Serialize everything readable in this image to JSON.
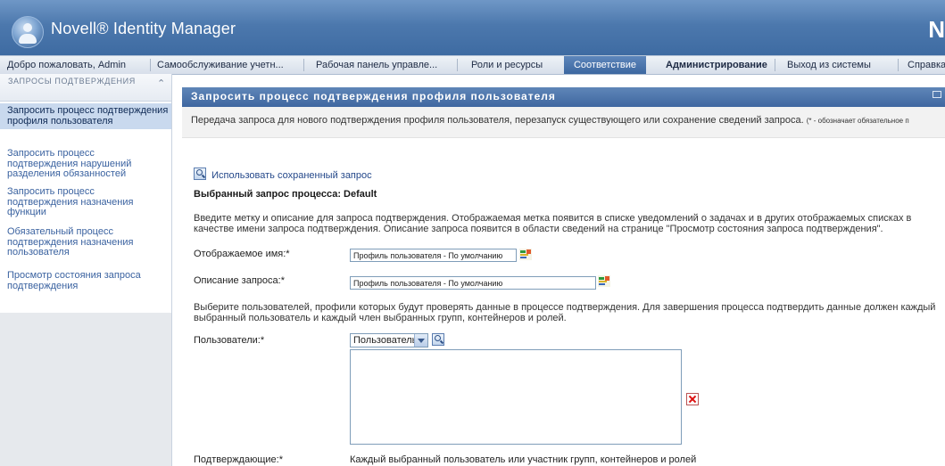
{
  "app": {
    "title": "Novell® Identity Manager",
    "corner_letter": "N"
  },
  "nav": {
    "welcome": "Добро пожаловать, Admin",
    "items": [
      {
        "label": "Самообслуживание учетн..."
      },
      {
        "label": "Рабочая панель управле..."
      },
      {
        "label": "Роли и ресурсы"
      },
      {
        "label": "Соответствие"
      },
      {
        "label": "Администрирование"
      },
      {
        "label": "Выход из системы"
      },
      {
        "label": "Справка"
      }
    ]
  },
  "sidebar": {
    "section_title": "ЗАПРОСЫ ПОДТВЕРЖДЕНИЯ",
    "items": [
      {
        "label": "Запросить процесс подтверждения профиля пользователя",
        "selected": true
      },
      {
        "label": "Запросить процесс подтверждения нарушений разделения обязанностей"
      },
      {
        "label": "Запросить процесс подтверждения назначения функции"
      },
      {
        "label": "Обязательный процесс подтверждения назначения пользователя"
      },
      {
        "label": "Просмотр состояния запроса подтверждения"
      }
    ]
  },
  "main": {
    "title": "Запросить процесс подтверждения профиля пользователя",
    "description": "Передача запроса для нового подтверждения профиля пользователя, перезапуск существующего или сохранение сведений запроса.",
    "required_note": "(* - обозначает обязательное п",
    "saved_request_link": "Использовать сохраненный запрос",
    "selected_request": "Выбранный запрос процесса: Default",
    "intro_text": "Введите метку и описание для запроса подтверждения. Отображаемая метка появится в списке уведомлений о задачах и в других отображаемых списках в качестве имени запроса подтверждения. Описание запроса появится в области сведений на странице \"Просмотр состояния запроса подтверждения\".",
    "display_name_label": "Отображаемое имя:*",
    "display_name_value": "Профиль пользователя - По умолчанию",
    "request_desc_label": "Описание запроса:*",
    "request_desc_value": "Профиль пользователя - По умолчанию",
    "users_intro": "Выберите пользователей, профили которых будут проверять данные в процессе подтверждения. Для завершения процесса подтвердить данные должен каждый выбранный пользователь и каждый член выбранных групп, контейнеров и ролей.",
    "users_label": "Пользователи:*",
    "user_type_select": "Пользователь",
    "attesters_label": "Подтверждающие:*",
    "attesters_value": "Каждый выбранный пользователь или участник групп, контейнеров и ролей"
  }
}
